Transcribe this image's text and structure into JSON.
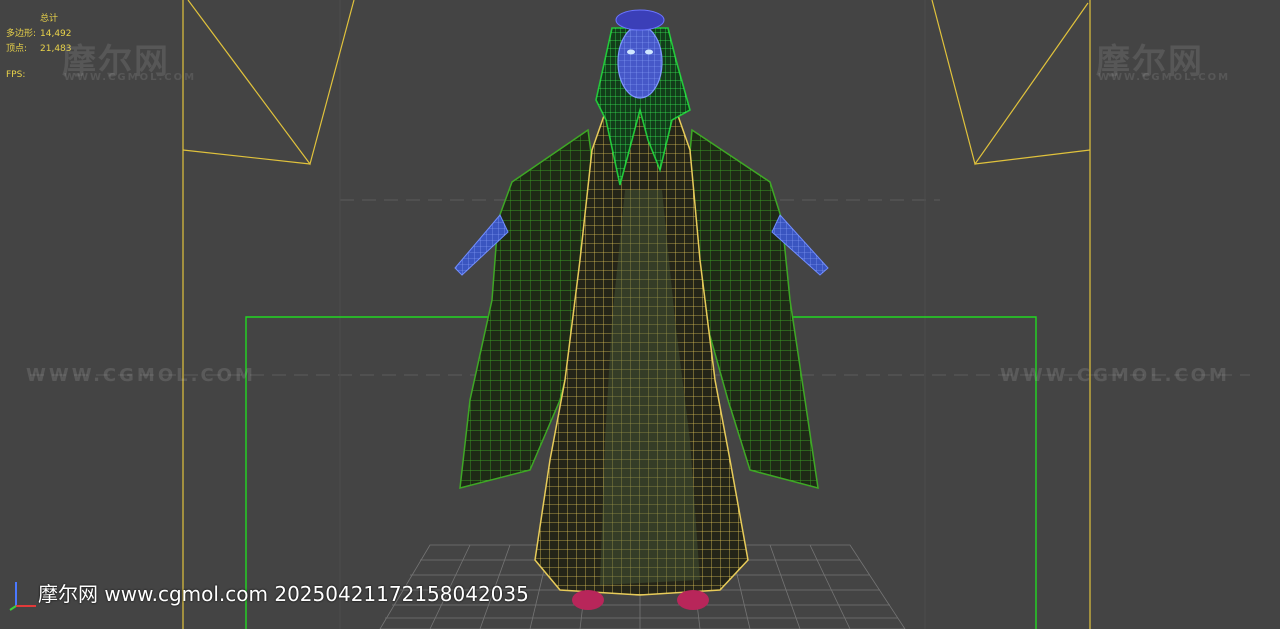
{
  "viewport_stats": {
    "title": "总计",
    "polygons_label": "多边形:",
    "polygons_value": "14,492",
    "vertices_label": "顶点:",
    "vertices_value": "21,483",
    "fps_label": "FPS:"
  },
  "watermarks": {
    "brand_cn": "摩尔网",
    "brand_url_caps": "WWW.CGMOL.COM",
    "footer_text": "摩尔网 www.cgmol.com 20250421172158042035"
  },
  "colors": {
    "background": "#444444",
    "camera_lines": "#e0c23c",
    "bounding_box": "#22d822",
    "dress_wire": "#e8cc5a",
    "sleeve_wire": "#3ea825",
    "hair_wire": "#22c83a",
    "skin_wire": "#4a6ee0",
    "grid": "#7a7a7a"
  }
}
